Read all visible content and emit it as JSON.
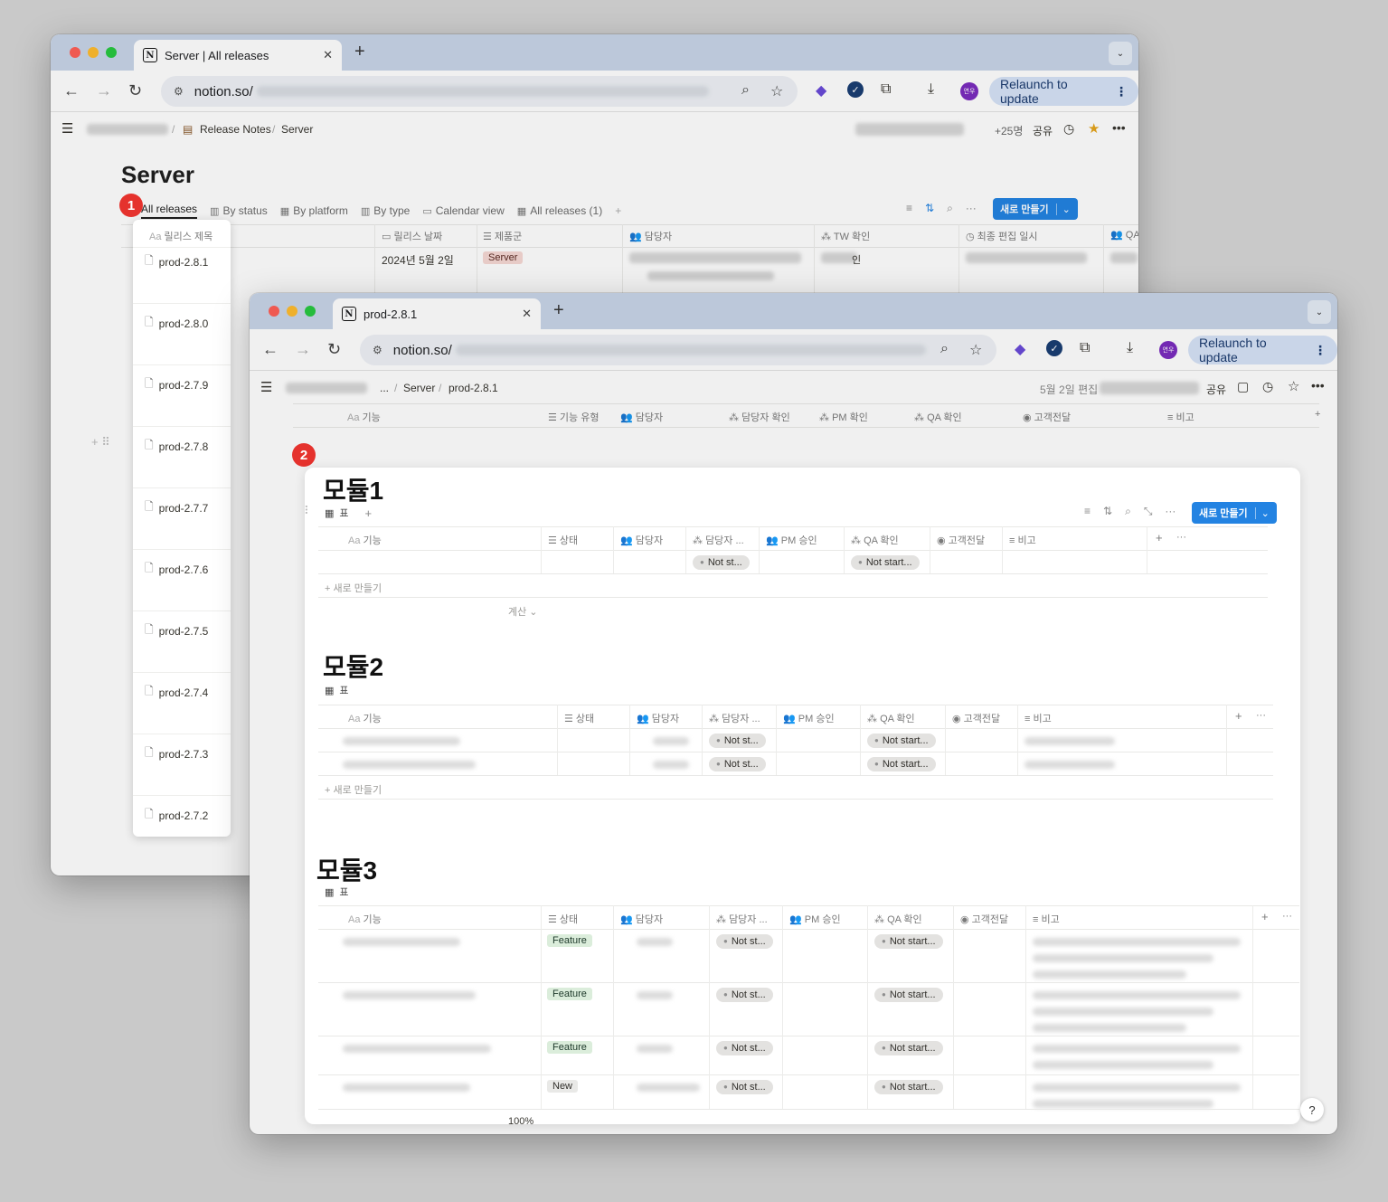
{
  "back_window": {
    "tab_title": "Server | All releases",
    "address_prefix": "notion.so/",
    "relaunch_label": "Relaunch to update",
    "breadcrumb": [
      "Release Notes",
      "Server"
    ],
    "sep": "/",
    "member_count": "+25명",
    "share_label": "공유",
    "page_title": "Server",
    "views": [
      {
        "label": "All releases",
        "icon": "table-icon"
      },
      {
        "label": "By status",
        "icon": "board-icon"
      },
      {
        "label": "By platform",
        "icon": "table-icon"
      },
      {
        "label": "By type",
        "icon": "board-icon"
      },
      {
        "label": "Calendar view",
        "icon": "calendar-icon"
      },
      {
        "label": "All releases (1)",
        "icon": "table-icon"
      }
    ],
    "new_button": "새로 만들기",
    "columns": [
      "릴리스 제목",
      "릴리스 날짜",
      "제품군",
      "담당자",
      "TW 확인",
      "최종 편집 일시",
      "QA"
    ],
    "first_row": {
      "date": "2024년 5월 2일",
      "product": "Server",
      "tw_tail": "인"
    },
    "releases": [
      "prod-2.8.1",
      "prod-2.8.0",
      "prod-2.7.9",
      "prod-2.7.8",
      "prod-2.7.7",
      "prod-2.7.6",
      "prod-2.7.5",
      "prod-2.7.4",
      "prod-2.7.3",
      "prod-2.7.2"
    ]
  },
  "badges": [
    "1",
    "2"
  ],
  "front_window": {
    "tab_title": "prod-2.8.1",
    "address_prefix": "notion.so/",
    "relaunch_label": "Relaunch to update",
    "breadcrumb": [
      "...",
      "Server",
      "prod-2.8.1"
    ],
    "sep": "/",
    "edited_label": "5월 2일 편집",
    "share_label": "공유",
    "top_columns": [
      "기능",
      "기능 유형",
      "담당자",
      "담당자 확인",
      "PM 확인",
      "QA 확인",
      "고객전달",
      "비고"
    ],
    "aa": "Aa",
    "table_view": "표",
    "new_button": "새로 만들기",
    "new_row": "새로 만들기",
    "calc": "계산",
    "zoom_label": "100%",
    "help": "?",
    "modules": [
      {
        "title": "모듈1",
        "columns": [
          "기능",
          "상태",
          "담당자",
          "담당자 ...",
          "PM 승인",
          "QA 확인",
          "고객전달",
          "비고"
        ],
        "rows": [
          {
            "status": "",
            "owner_check": "Not st...",
            "qa": "Not start..."
          }
        ]
      },
      {
        "title": "모듈2",
        "columns": [
          "기능",
          "상태",
          "담당자",
          "담당자 ...",
          "PM 승인",
          "QA 확인",
          "고객전달",
          "비고"
        ],
        "rows": [
          {
            "status": "",
            "owner_check": "Not st...",
            "qa": "Not start..."
          },
          {
            "status": "",
            "owner_check": "Not st...",
            "qa": "Not start..."
          }
        ]
      },
      {
        "title": "모듈3",
        "columns": [
          "기능",
          "상태",
          "담당자",
          "담당자 ...",
          "PM 승인",
          "QA 확인",
          "고객전달",
          "비고"
        ],
        "rows": [
          {
            "status": "Feature",
            "owner_check": "Not st...",
            "qa": "Not start..."
          },
          {
            "status": "Feature",
            "owner_check": "Not st...",
            "qa": "Not start..."
          },
          {
            "status": "Feature",
            "owner_check": "Not st...",
            "qa": "Not start..."
          },
          {
            "status": "New",
            "owner_check": "Not st...",
            "qa": "Not start..."
          }
        ]
      }
    ]
  },
  "colors": {
    "accent": "#2383e2",
    "badge": "#e5322d",
    "tabbar": "#c8d5e8"
  }
}
